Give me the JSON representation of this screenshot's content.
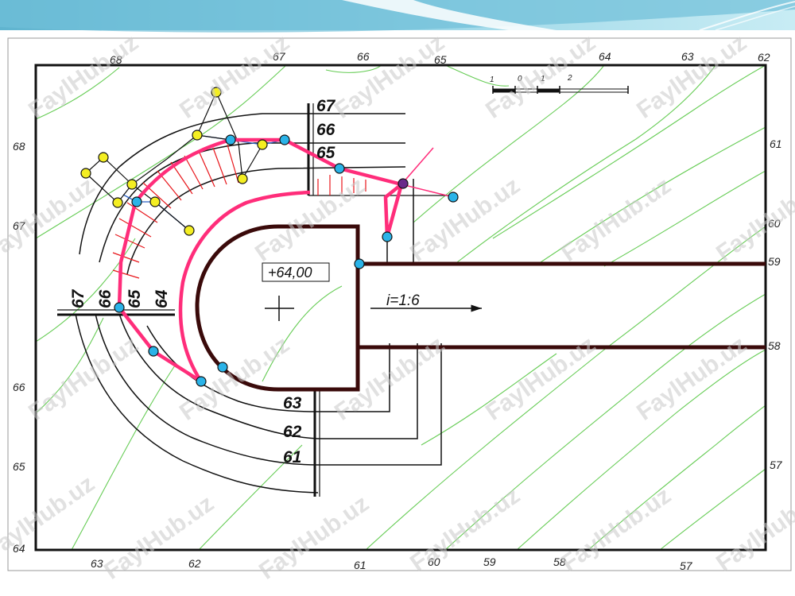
{
  "watermark": "FaylHub.uz",
  "colors": {
    "contour_green": "#66cc55",
    "fill_line": "#ff2d7a",
    "slope_hatch": "#e8161b",
    "node_cyan": "#2ab3e8",
    "node_yellow": "#f4ee22",
    "node_purple": "#6a2a8a",
    "frame": "#111111",
    "header_blue": "#7cc7dd"
  },
  "frame_labels": {
    "top": [
      "68",
      "67",
      "66",
      "65",
      "64",
      "63",
      "62"
    ],
    "left": [
      "68",
      "67",
      "66",
      "65",
      "64"
    ],
    "right": [
      "61",
      "60",
      "59",
      "58",
      "57"
    ],
    "bottom": [
      "63",
      "62",
      "61",
      "60",
      "59",
      "58",
      "57"
    ]
  },
  "scale_bar": [
    "1",
    "0",
    "1",
    "2"
  ],
  "slope_scales": {
    "cut_upper": [
      "67",
      "66",
      "65"
    ],
    "cut_left": [
      "67",
      "66",
      "65",
      "64"
    ],
    "fill_lower": [
      "63",
      "62",
      "61"
    ]
  },
  "pad_elevation": "+64,00",
  "road_slope": "i=1:6"
}
